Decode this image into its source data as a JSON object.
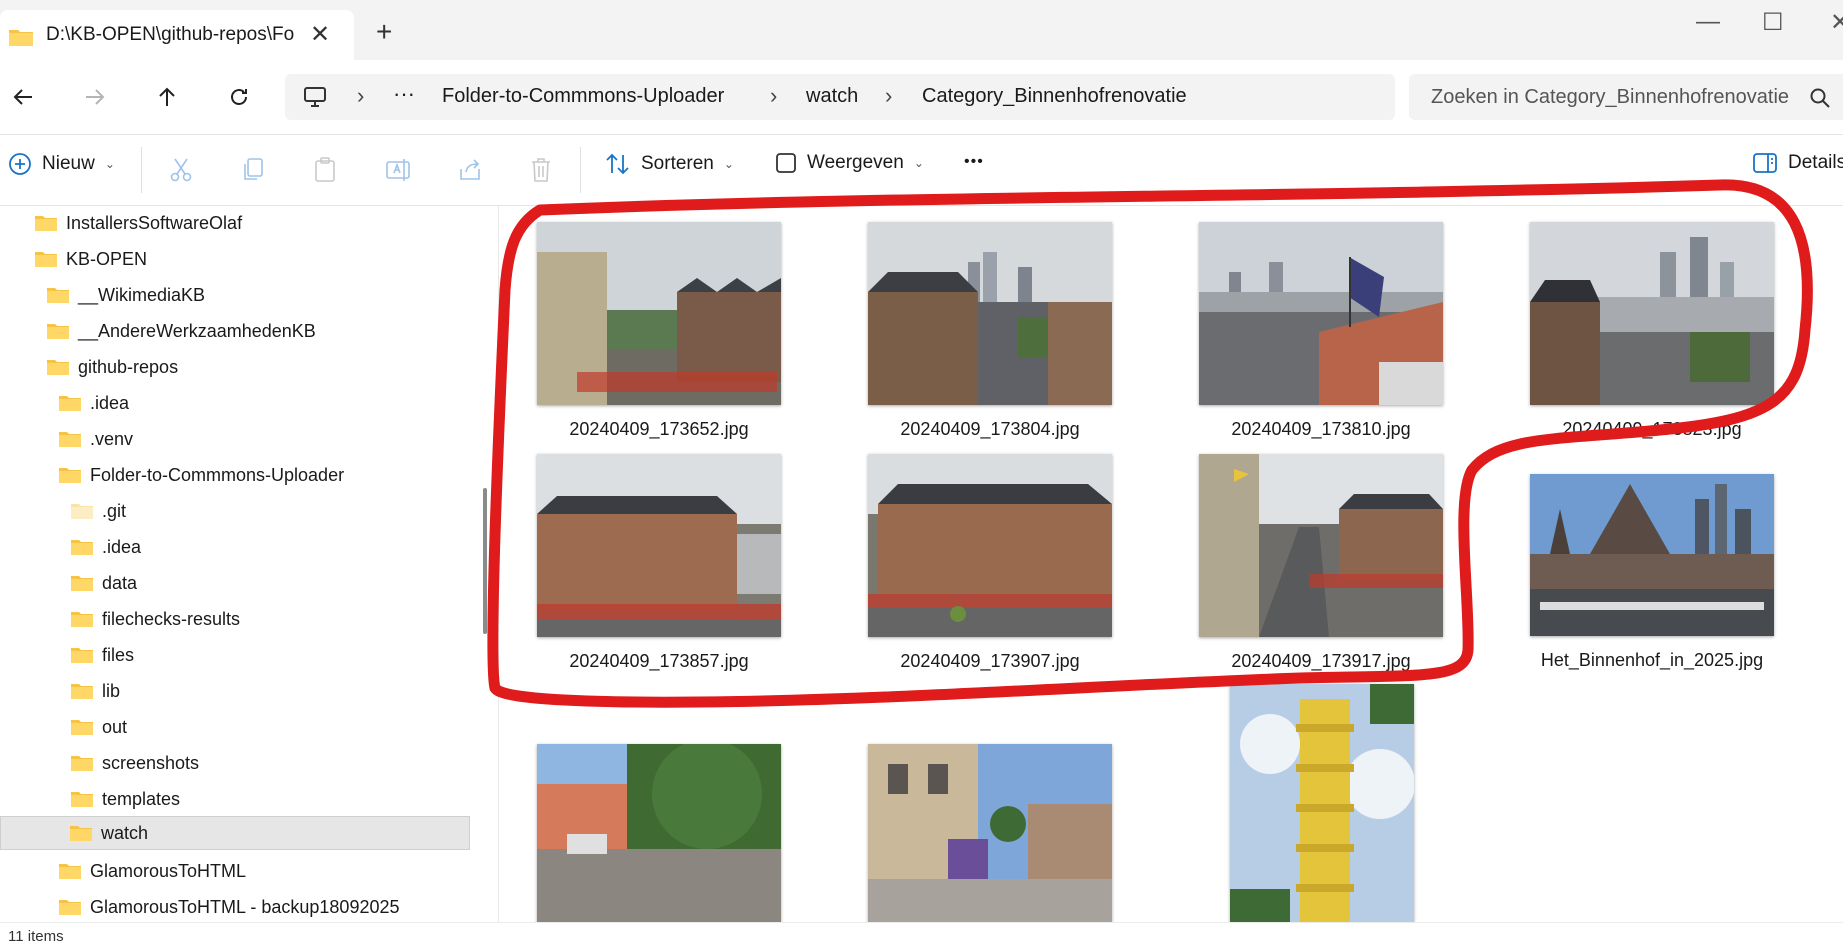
{
  "window": {
    "tab_title": "D:\\KB-OPEN\\github-repos\\Fo",
    "close_tab_glyph": "✕",
    "new_tab_glyph": "+",
    "minimize_glyph": "—",
    "maximize_glyph": "☐",
    "close_glyph": "✕"
  },
  "address": {
    "more_glyph": "···",
    "crumbs": [
      "Folder-to-Commmons-Uploader",
      "watch",
      "Category_Binnenhofrenovatie"
    ],
    "search_placeholder": "Zoeken in Category_Binnenhofrenovatie"
  },
  "toolbar": {
    "new_label": "Nieuw",
    "sort_label": "Sorteren",
    "view_label": "Weergeven",
    "more_glyph": "•••",
    "details_label": "Details"
  },
  "nav": {
    "items": [
      {
        "label": "InstallersSoftwareOlaf"
      },
      {
        "label": "KB-OPEN"
      },
      {
        "label": "__WikimediaKB"
      },
      {
        "label": "__AndereWerkzaamhedenKB"
      },
      {
        "label": "github-repos"
      },
      {
        "label": ".idea"
      },
      {
        "label": ".venv"
      },
      {
        "label": "Folder-to-Commmons-Uploader"
      },
      {
        "label": ".git"
      },
      {
        "label": ".idea"
      },
      {
        "label": "data"
      },
      {
        "label": "filechecks-results"
      },
      {
        "label": "files"
      },
      {
        "label": "lib"
      },
      {
        "label": "out"
      },
      {
        "label": "screenshots"
      },
      {
        "label": "templates"
      },
      {
        "label": "watch"
      },
      {
        "label": "GlamorousToHTML"
      },
      {
        "label": "GlamorousToHTML - backup18092025"
      }
    ]
  },
  "files": [
    {
      "name": "20240409_173652.jpg"
    },
    {
      "name": "20240409_173804.jpg"
    },
    {
      "name": "20240409_173810.jpg"
    },
    {
      "name": "20240409_173823.jpg"
    },
    {
      "name": "20240409_173857.jpg"
    },
    {
      "name": "20240409_173907.jpg"
    },
    {
      "name": "20240409_173917.jpg"
    },
    {
      "name": "Het_Binnenhof_in_2025.jpg"
    },
    {
      "name": ""
    },
    {
      "name": ""
    },
    {
      "name": ""
    }
  ],
  "status": {
    "item_count": "11 items"
  },
  "colors": {
    "annotation": "#e01b1b",
    "folder": "#f6c445",
    "accent": "#1a73c8"
  }
}
